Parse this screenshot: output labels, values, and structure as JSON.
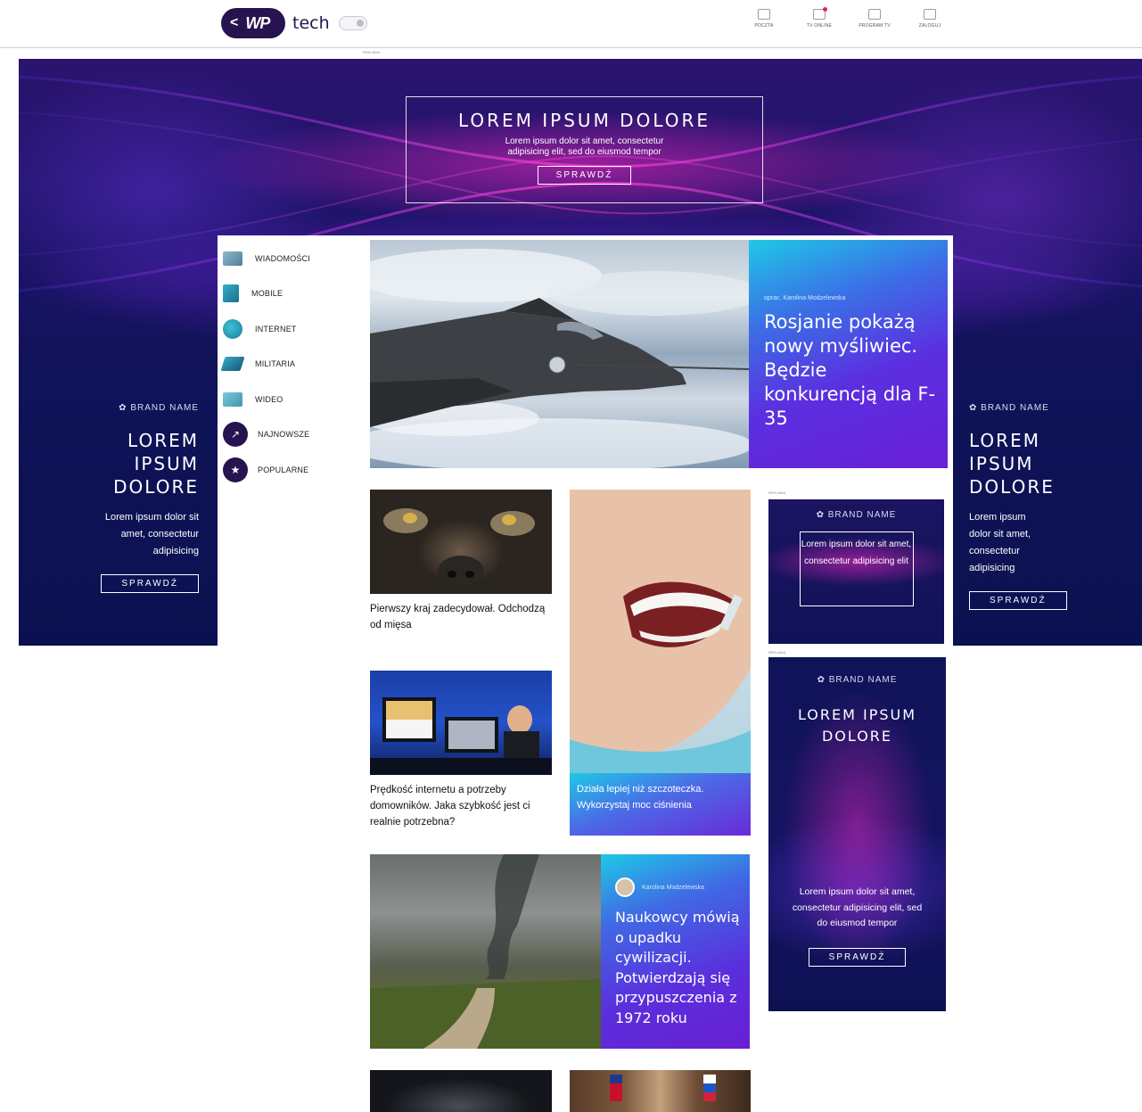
{
  "header": {
    "logo_chevron": "<",
    "logo_wp": "WP",
    "logo_tech": "tech",
    "nav": [
      {
        "label": "POCZTA",
        "icon": "mail-icon",
        "badge": false
      },
      {
        "label": "TV ONLINE",
        "icon": "tv-online-icon",
        "badge": true
      },
      {
        "label": "PROGRAM TV",
        "icon": "tv-program-icon",
        "badge": false
      },
      {
        "label": "ZALOGUJ",
        "icon": "login-icon",
        "badge": false
      }
    ],
    "ad_label": "REKLAMA"
  },
  "hero_ad": {
    "title": "LOREM  IPSUM  DOLORE",
    "text": "Lorem ipsum dolor sit amet, consectetur adipisicing elit, sed do eiusmod tempor",
    "button": "SPRAWDŹ"
  },
  "side_ads": {
    "left": {
      "brand": "BRAND NAME",
      "line1": "LOREM",
      "line2": "IPSUM",
      "line3": "DOLORE",
      "text": "Lorem ipsum dolor sit amet, consectetur adipisicing",
      "button": "SPRAWDŹ"
    },
    "right": {
      "brand": "BRAND NAME",
      "line1": "LOREM",
      "line2": "IPSUM",
      "line3": "DOLORE",
      "text": "Lorem ipsum dolor sit amet, consectetur adipisicing",
      "button": "SPRAWDŹ"
    }
  },
  "menu": [
    {
      "label": "WIADOMOŚCI",
      "icon": "news-icon"
    },
    {
      "label": "MOBILE",
      "icon": "mobile-icon"
    },
    {
      "label": "INTERNET",
      "icon": "globe-icon"
    },
    {
      "label": "MILITARIA",
      "icon": "military-icon"
    },
    {
      "label": "WIDEO",
      "icon": "video-icon"
    },
    {
      "label": "NAJNOWSZE",
      "icon": "trending-icon"
    },
    {
      "label": "POPULARNE",
      "icon": "star-icon"
    }
  ],
  "feature": {
    "meta": "oprac. Karolina Modzelewska",
    "title": "Rosjanie pokażą nowy myśliwiec. Będzie konkurencją dla F-35"
  },
  "cards": {
    "cow": "Pierwszy kraj zadecydował. Odchodzą od mięsa",
    "internet": "Prędkość internetu a potrzeby domowników. Jaka szybkość jest ci realnie potrzebna?",
    "tall": "Działa lepiej niż szczoteczka. Wykorzystaj moc ciśnienia"
  },
  "wide": {
    "author": "Karolina Modzelewska",
    "title": "Naukowcy mówią o upadku cywilizacji. Potwierdzają się przypuszczenia z 1972 roku"
  },
  "ad_small": {
    "label": "REKLAMA",
    "brand": "BRAND NAME",
    "text": "Lorem ipsum dolor sit amet, consectetur adipisicing elit"
  },
  "ad_tall": {
    "label": "REKLAMA",
    "brand": "BRAND NAME",
    "title1": "LOREM  IPSUM",
    "title2": "DOLORE",
    "text": "Lorem ipsum dolor sit amet, consectetur adipisicing elit, sed do eiusmod tempor",
    "button": "SPRAWDŹ"
  },
  "colors": {
    "brand_navy": "#26134f",
    "ad_navy": "#101257",
    "accent_pink": "#ff2bc8",
    "panel_cyan": "#1ec9e6",
    "panel_violet": "#6a1fd6"
  }
}
